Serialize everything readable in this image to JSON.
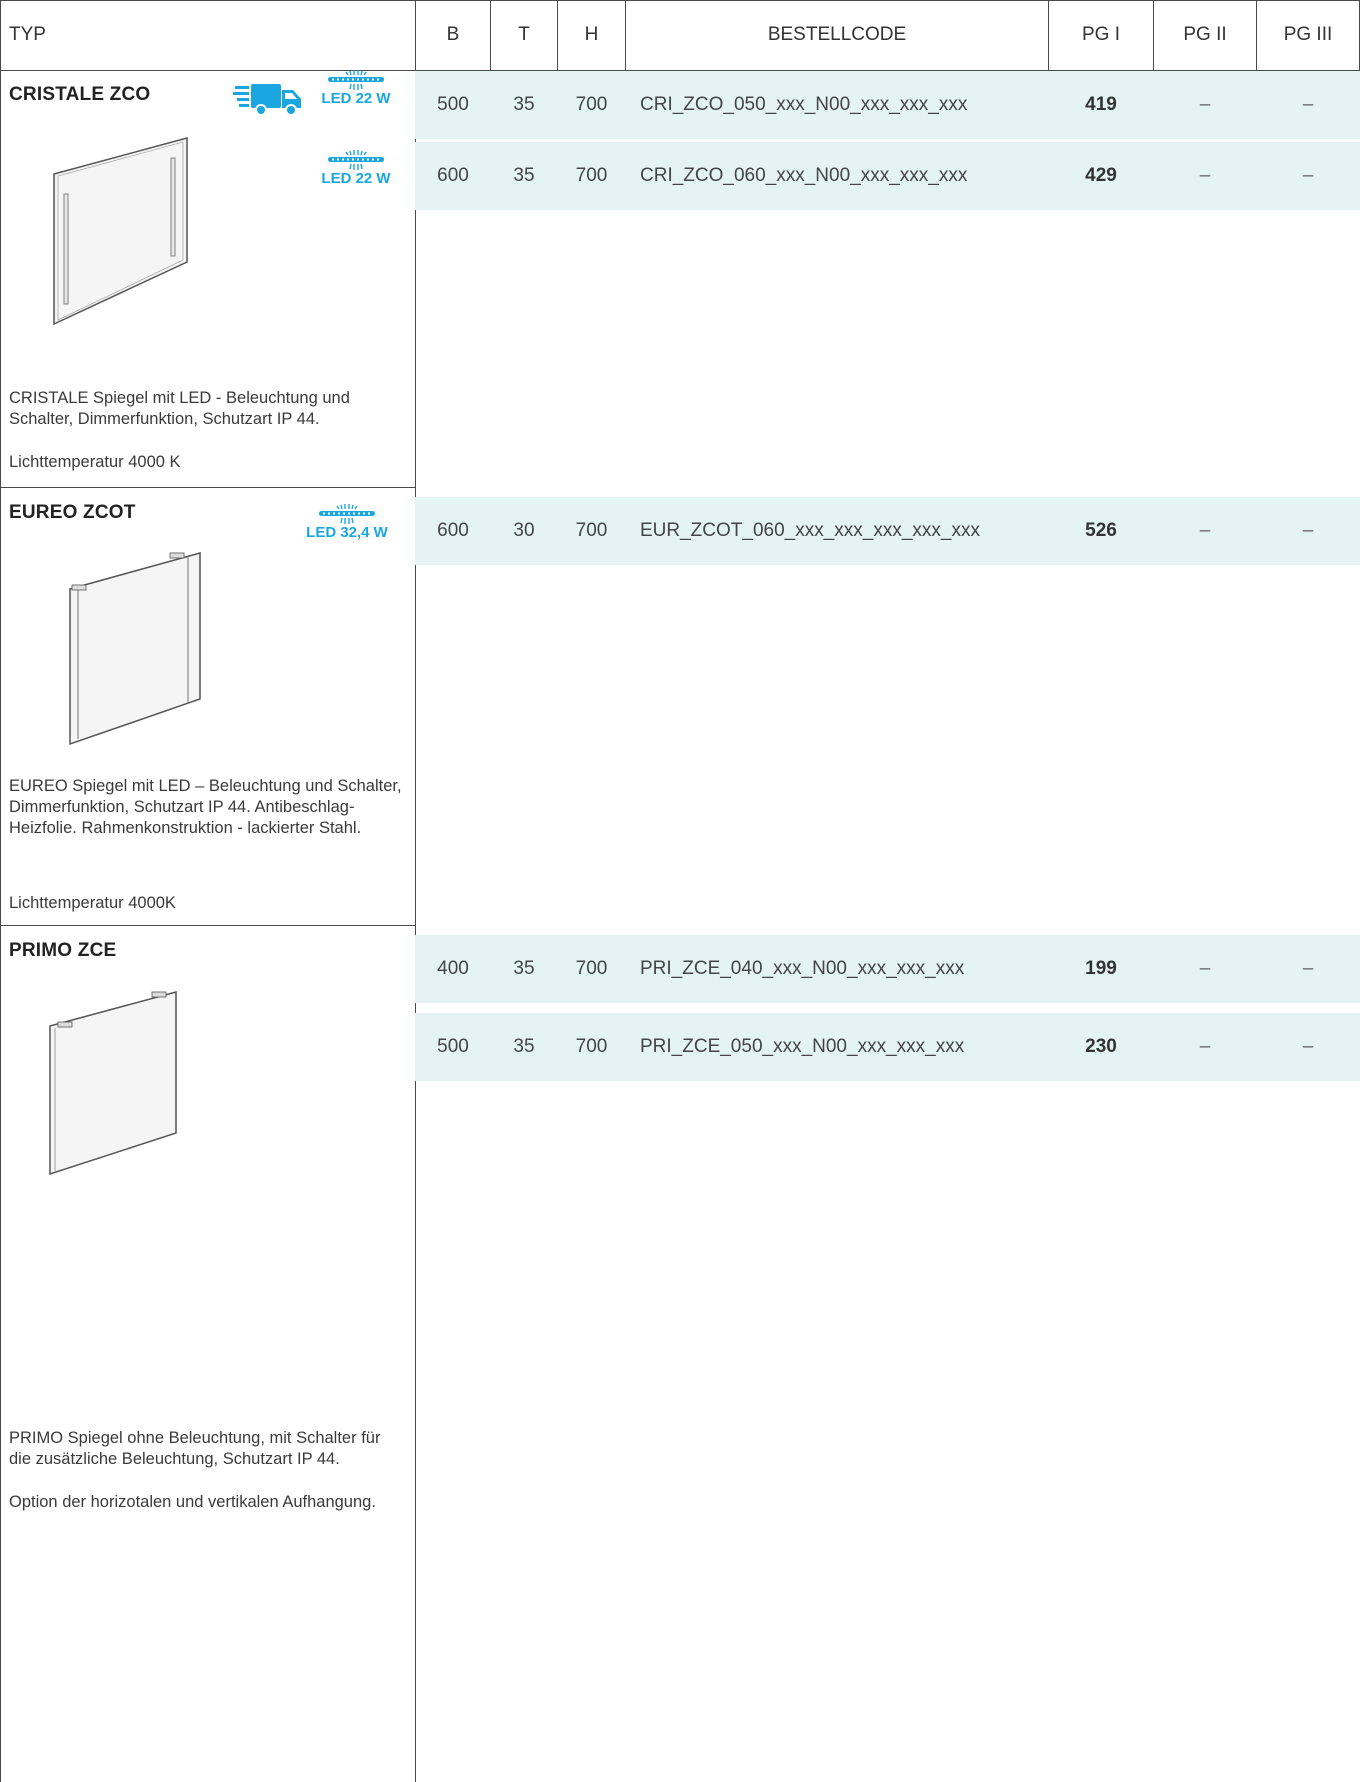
{
  "columns": {
    "typ": "TYP",
    "b": "B",
    "t": "T",
    "h": "H",
    "code": "BESTELLCODE",
    "pg1": "PG I",
    "pg2": "PG II",
    "pg3": "PG III"
  },
  "accent_color": "#1aa7e0",
  "row_band_color": "#e4f4f3",
  "products": [
    {
      "title": "CRISTALE ZCO",
      "badges": [
        "delivery-truck-icon"
      ],
      "led_labels": [
        "LED 22 W",
        "LED 22 W"
      ],
      "description": "CRISTALE Spiegel mit LED - Beleuchtung und Schalter, Dimmerfunktion, Schutzart IP 44.",
      "note": "Lichttemperatur  4000 K",
      "rows": [
        {
          "b": "500",
          "t": "35",
          "h": "700",
          "code": "CRI_ZCO_050_xxx_N00_xxx_xxx_xxx",
          "pg1": "419",
          "pg2": "–",
          "pg3": "–"
        },
        {
          "b": "600",
          "t": "35",
          "h": "700",
          "code": "CRI_ZCO_060_xxx_N00_xxx_xxx_xxx",
          "pg1": "429",
          "pg2": "–",
          "pg3": "–"
        }
      ]
    },
    {
      "title": "EUREO ZCOT",
      "led_labels": [
        "LED 32,4 W"
      ],
      "description": "EUREO Spiegel mit LED – Beleuchtung und Schalter, Dimmerfunktion, Schutzart IP 44. Antibeschlag-Heizfolie. Rahmenkonstruktion - lackierter Stahl.",
      "note": "Lichttemperatur  4000K",
      "rows": [
        {
          "b": "600",
          "t": "30",
          "h": "700",
          "code": "EUR_ZCOT_060_xxx_xxx_xxx_xxx_xxx",
          "pg1": "526",
          "pg2": "–",
          "pg3": "–"
        }
      ]
    },
    {
      "title": "PRIMO ZCE",
      "description": "PRIMO Spiegel ohne Beleuchtung, mit Schalter für die zusätzliche Beleuchtung, Schutzart IP 44.",
      "note": "Option der horizotalen und vertikalen Aufhangung.",
      "rows": [
        {
          "b": "400",
          "t": "35",
          "h": "700",
          "code": "PRI_ZCE_040_xxx_N00_xxx_xxx_xxx",
          "pg1": "199",
          "pg2": "–",
          "pg3": "–"
        },
        {
          "b": "500",
          "t": "35",
          "h": "700",
          "code": "PRI_ZCE_050_xxx_N00_xxx_xxx_xxx",
          "pg1": "230",
          "pg2": "–",
          "pg3": "–"
        }
      ]
    }
  ]
}
